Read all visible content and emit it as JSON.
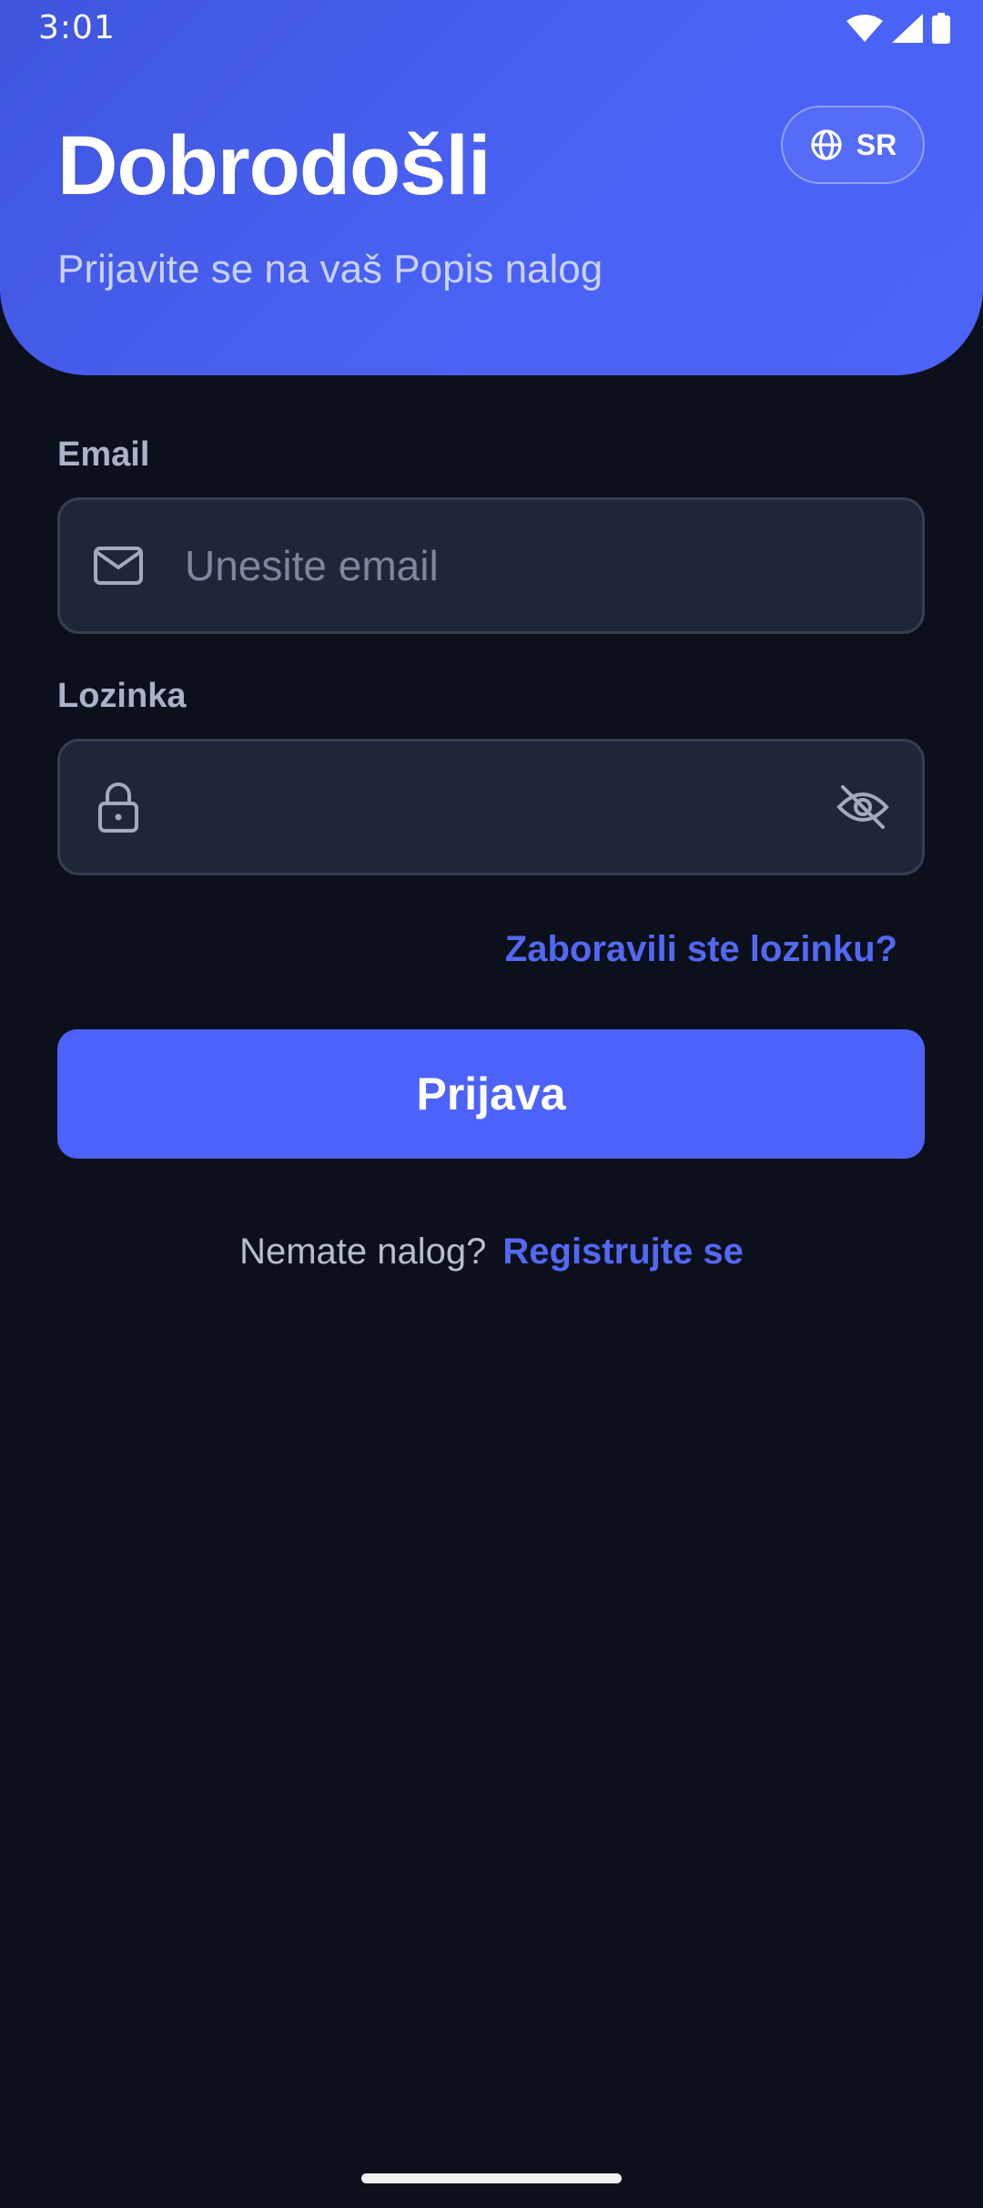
{
  "status_bar": {
    "time": "3:01",
    "icons": [
      "wifi-icon",
      "signal-icon",
      "battery-icon"
    ]
  },
  "header": {
    "title": "Dobrodošli",
    "subtitle": "Prijavite se na vaš Popis nalog",
    "language": {
      "icon": "globe-icon",
      "label": "SR"
    }
  },
  "form": {
    "email": {
      "label": "Email",
      "placeholder": "Unesite email",
      "value": "",
      "icon": "mail-icon"
    },
    "password": {
      "label": "Lozinka",
      "placeholder": "",
      "value": "",
      "icon": "lock-icon",
      "toggle_icon": "eye-off-icon"
    },
    "forgot_password": "Zaboravili ste lozinku?",
    "submit_label": "Prijava"
  },
  "register": {
    "prompt": "Nemate nalog?",
    "link": "Registrujte se"
  },
  "colors": {
    "accent": "#4C62FA",
    "background": "#0C101C",
    "input_bg": "#1F2637",
    "link": "#5369F3"
  }
}
